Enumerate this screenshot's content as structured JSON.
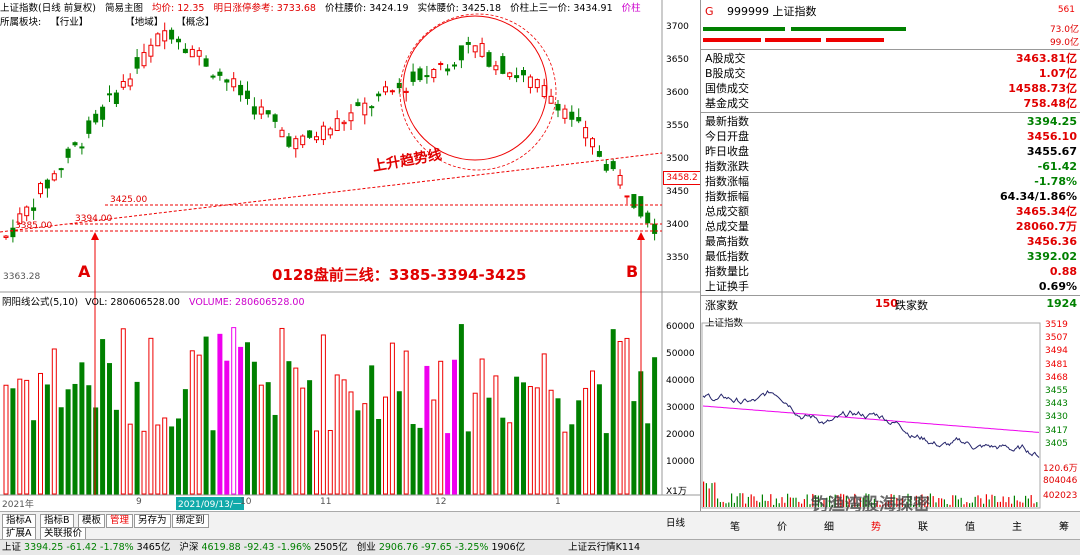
{
  "header": {
    "index_name": "上证指数(日线 前复权)",
    "icon_label": "简易主图",
    "avg_label": "均价: 12.35",
    "ref_label": "明日涨停参考: 3733.68",
    "pillar_label": "价柱腰价: 3424.19",
    "entity_label": "实体腰价: 3425.18",
    "upper_label": "价柱上三一价: 3434.91",
    "end_label": "价柱"
  },
  "sector_bar": {
    "label": "所属板块:",
    "industry": "【行业】",
    "region": "【地域】",
    "concept": "【概念】"
  },
  "price_axis": [
    "3700",
    "3650",
    "3600",
    "3550",
    "3500",
    "3450",
    "3400",
    "3350"
  ],
  "current_price_tag": "3458.2",
  "annotations": {
    "line_3425": "3425.00",
    "line_3394": "3394.00",
    "line_3385": "3385.00",
    "low_label": "3363.28",
    "trend_label": "上升趋势线",
    "point_a": "A",
    "point_b": "B",
    "headline": "0128盘前三线：3385-3394-3425"
  },
  "volume_header": {
    "formula": "阴阳线公式(5,10)",
    "vol": "VOL: 280606528.00",
    "volume": "VOLUME: 280606528.00"
  },
  "volume_axis": [
    "60000",
    "50000",
    "40000",
    "30000",
    "20000",
    "10000"
  ],
  "volume_unit": "X1万",
  "date_axis": [
    "2021年",
    "9",
    "2021/09/13/一",
    "10",
    "11",
    "12",
    "1"
  ],
  "bottom_tabs": [
    "指标A",
    "指标B",
    "模板",
    "管理",
    "另存为",
    "绑定到"
  ],
  "bottom_tabs2": [
    "扩展A",
    "关联报价"
  ],
  "period_label": "日线",
  "quote": {
    "code": "999999",
    "name": "上证指数",
    "g_label": "G",
    "suffix": "561",
    "bar_top_right": "73.0亿",
    "bar_bottom_right": "99.0亿"
  },
  "turnover": [
    {
      "label": "A股成交",
      "value": "3463.81亿",
      "color": "red"
    },
    {
      "label": "B股成交",
      "value": "1.07亿",
      "color": "red"
    },
    {
      "label": "国债成交",
      "value": "14588.73亿",
      "color": "red"
    },
    {
      "label": "基金成交",
      "value": "758.48亿",
      "color": "red"
    }
  ],
  "stats": [
    {
      "label": "最新指数",
      "value": "3394.25",
      "color": "green"
    },
    {
      "label": "今日开盘",
      "value": "3456.10",
      "color": "red"
    },
    {
      "label": "昨日收盘",
      "value": "3455.67",
      "color": "black"
    },
    {
      "label": "指数涨跌",
      "value": "-61.42",
      "color": "green"
    },
    {
      "label": "指数涨幅",
      "value": "-1.78%",
      "color": "green"
    },
    {
      "label": "指数振幅",
      "value": "64.34/1.86%",
      "color": "black"
    },
    {
      "label": "总成交额",
      "value": "3465.34亿",
      "color": "red"
    },
    {
      "label": "总成交量",
      "value": "28060.7万",
      "color": "red"
    },
    {
      "label": "最高指数",
      "value": "3456.36",
      "color": "red"
    },
    {
      "label": "最低指数",
      "value": "3392.02",
      "color": "green"
    },
    {
      "label": "指数量比",
      "value": "0.88",
      "color": "red"
    },
    {
      "label": "上证换手",
      "value": "0.69%",
      "color": "black"
    }
  ],
  "breadth": {
    "up_label": "涨家数",
    "up_value": "150",
    "down_label": "跌家数",
    "down_value": "1924"
  },
  "intraday": {
    "title": "上证指数",
    "axis": [
      "3519",
      "3507",
      "3494",
      "3481",
      "3468",
      "3455",
      "3443",
      "3430",
      "3417",
      "3405"
    ],
    "bottom_left": "120.6万",
    "vol1": "804046",
    "vol2": "402023"
  },
  "intraday_tabs": [
    "笔",
    "价",
    "细",
    "势",
    "联",
    "值",
    "主",
    "筹"
  ],
  "watermark": "钓渔湾股海探密",
  "status_bar": {
    "sh_label": "上证",
    "sh_value": "3394.25",
    "sh_change": "-61.42",
    "sh_pct": "-1.78%",
    "sh_amount": "3465亿",
    "hs_label": "沪深",
    "hs_value": "4619.88",
    "hs_change": "-92.43",
    "hs_pct": "-1.96%",
    "hs_amount": "2505亿",
    "cy_label": "创业",
    "cy_value": "2906.76",
    "cy_change": "-97.65",
    "cy_pct": "-3.25%",
    "cy_amount": "1906亿",
    "cloud": "上证云行情K114"
  }
}
